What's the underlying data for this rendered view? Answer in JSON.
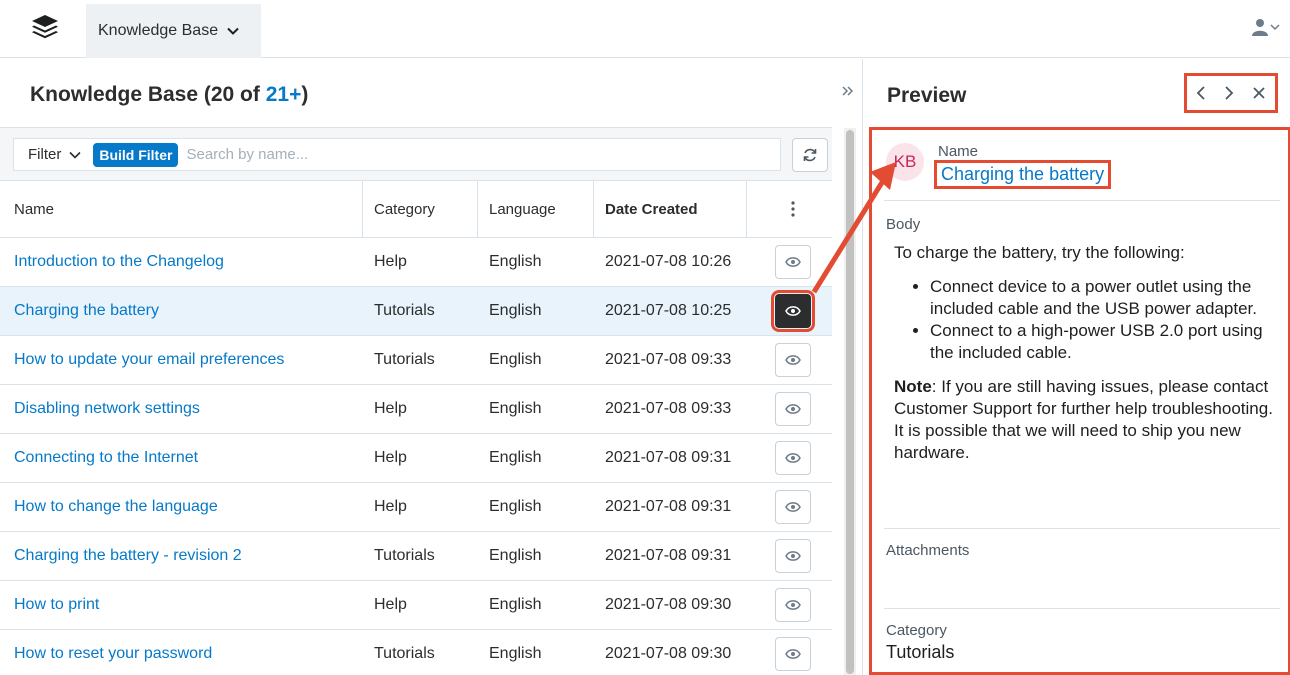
{
  "nav": {
    "module_label": "Knowledge Base"
  },
  "list": {
    "title_prefix": "Knowledge Base (20 of ",
    "count_link": "21+",
    "title_suffix": ")",
    "filter_label": "Filter",
    "build_filter_label": "Build Filter",
    "search_placeholder": "Search by name...",
    "columns": {
      "name": "Name",
      "category": "Category",
      "language": "Language",
      "date_created": "Date Created"
    },
    "rows": [
      {
        "name": "Introduction to the Changelog",
        "category": "Help",
        "language": "English",
        "date": "2021-07-08 10:26"
      },
      {
        "name": "Charging the battery",
        "category": "Tutorials",
        "language": "English",
        "date": "2021-07-08 10:25"
      },
      {
        "name": "How to update your email preferences",
        "category": "Tutorials",
        "language": "English",
        "date": "2021-07-08 09:33"
      },
      {
        "name": "Disabling network settings",
        "category": "Help",
        "language": "English",
        "date": "2021-07-08 09:33"
      },
      {
        "name": "Connecting to the Internet",
        "category": "Help",
        "language": "English",
        "date": "2021-07-08 09:31"
      },
      {
        "name": "How to change the language",
        "category": "Help",
        "language": "English",
        "date": "2021-07-08 09:31"
      },
      {
        "name": "Charging the battery - revision 2",
        "category": "Tutorials",
        "language": "English",
        "date": "2021-07-08 09:31"
      },
      {
        "name": "How to print",
        "category": "Help",
        "language": "English",
        "date": "2021-07-08 09:30"
      },
      {
        "name": "How to reset your password",
        "category": "Tutorials",
        "language": "English",
        "date": "2021-07-08 09:30"
      }
    ]
  },
  "preview": {
    "title": "Preview",
    "avatar_initials": "KB",
    "name_label": "Name",
    "name_value": "Charging the battery",
    "body_label": "Body",
    "body_intro": "To charge the battery, try the following:",
    "body_bullets": [
      "Connect device to a power outlet using the included cable and the USB power adapter.",
      "Connect to a high-power USB 2.0 port using the included cable."
    ],
    "note_label": "Note",
    "note_text": ": If you are still having issues, please contact Customer Support for further help troubleshooting. It is possible that we will need to ship you new hardware.",
    "attachments_label": "Attachments",
    "category_label": "Category",
    "category_value": "Tutorials"
  },
  "colors": {
    "accent": "#0679c8",
    "annotation": "#e34b32",
    "selected_row": "#e8f3fb"
  },
  "selected_row_index": 1
}
